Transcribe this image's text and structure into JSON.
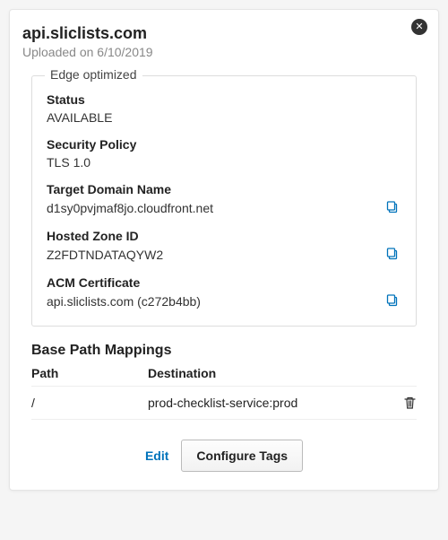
{
  "header": {
    "title": "api.sliclists.com",
    "uploaded": "Uploaded on 6/10/2019"
  },
  "edge": {
    "legend": "Edge optimized",
    "status_label": "Status",
    "status_value": "AVAILABLE",
    "policy_label": "Security Policy",
    "policy_value": "TLS 1.0",
    "target_label": "Target Domain Name",
    "target_value": "d1sy0pvjmaf8jo.cloudfront.net",
    "zone_label": "Hosted Zone ID",
    "zone_value": "Z2FDTNDATAQYW2",
    "acm_label": "ACM Certificate",
    "acm_value": "api.sliclists.com (c272b4bb)"
  },
  "mappings": {
    "heading": "Base Path Mappings",
    "col_path": "Path",
    "col_dest": "Destination",
    "rows": [
      {
        "path": "/",
        "dest": "prod-checklist-service:prod"
      }
    ]
  },
  "actions": {
    "edit": "Edit",
    "configure": "Configure Tags"
  }
}
